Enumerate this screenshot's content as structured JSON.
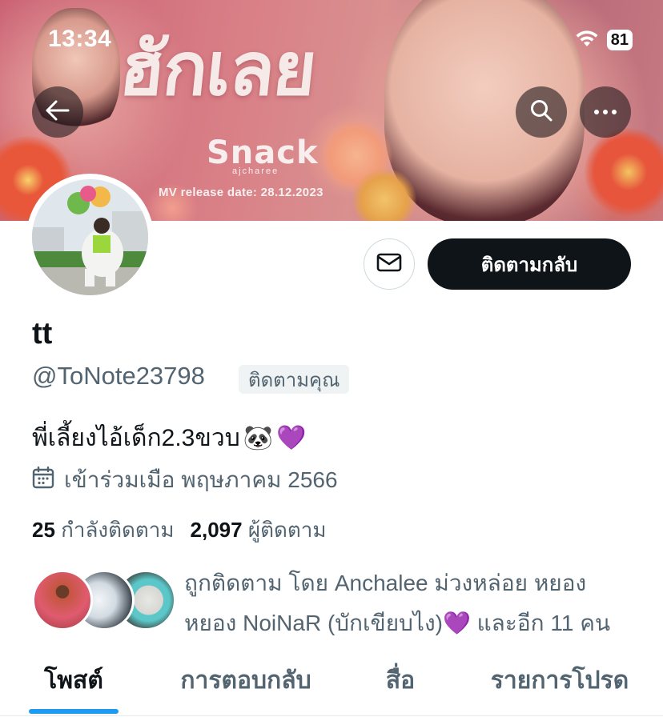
{
  "status_bar": {
    "time": "13:34",
    "battery": "81"
  },
  "banner": {
    "title": "ฮักเลย",
    "brand": "Snack",
    "brand_sub": "ajcharee",
    "release": "MV release date: 28.12.2023"
  },
  "nav": {
    "back_icon": "arrow-left-icon",
    "search_icon": "search-icon",
    "more_icon": "more-dots-icon"
  },
  "actions": {
    "message_icon": "envelope-icon",
    "follow_back_label": "ติดตามกลับ"
  },
  "profile": {
    "name": "tt",
    "handle": "@ToNote23798",
    "follows_you": "ติดตามคุณ",
    "bio": "พี่เลี้ยงไอ้เด็ก2.3ขวบ",
    "bio_emojis": [
      "🐼",
      "💜"
    ],
    "joined": "เข้าร่วมเมือ พฤษภาคม 2566",
    "following_count": "25",
    "following_label": "กำลังติดตาม",
    "followers_count": "2,097",
    "followers_label": "ผู้ติดตาม"
  },
  "mutuals": {
    "line1": "ถูกติดตาม โดย Anchalee ม่วงหล่อย หยอง",
    "line2": "หยอง NoiNaR (บักเขียบไง)💜 และอีก 11 คน"
  },
  "tabs": [
    {
      "label": "โพสต์",
      "active": true
    },
    {
      "label": "การตอบกลับ",
      "active": false
    },
    {
      "label": "สื่อ",
      "active": false
    },
    {
      "label": "รายการโปรด",
      "active": false
    }
  ],
  "colors": {
    "accent": "#1d9bf0",
    "text": "#0f1419",
    "secondary": "#536471",
    "button_dark": "#0f1419"
  }
}
